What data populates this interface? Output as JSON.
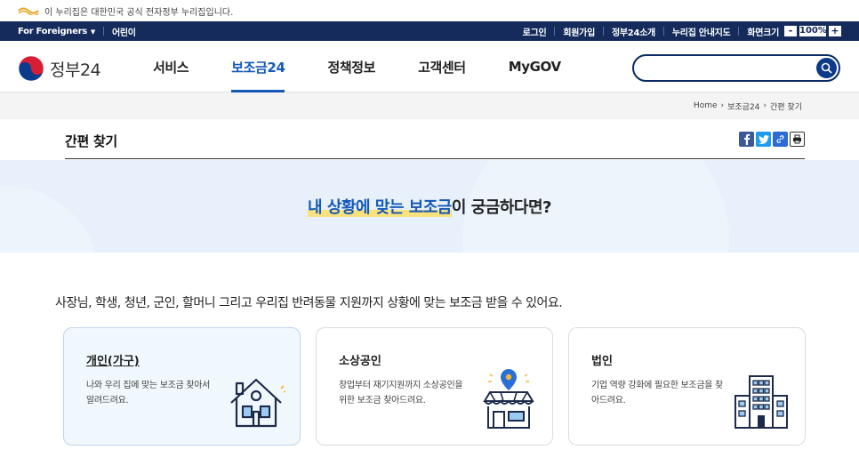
{
  "gov_banner": {
    "text": "이 누리집은 대한민국 공식 전자정부 누리집입니다."
  },
  "util": {
    "left": [
      "For Foreigners",
      "어린이"
    ],
    "right": [
      "로그인",
      "회원가입",
      "정부24소개",
      "누리집 안내지도",
      "화면크기"
    ],
    "zoom_minus": "-",
    "zoom_value": "100%",
    "zoom_plus": "+"
  },
  "nav": {
    "logo_text": "정부24",
    "menu": [
      "서비스",
      "보조금24",
      "정책정보",
      "고객센터",
      "MyGOV"
    ],
    "active_index": 1,
    "search_placeholder": ""
  },
  "breadcrumb": [
    "Home",
    "보조금24",
    "간편 찾기"
  ],
  "page_title": "간편 찾기",
  "hero": {
    "highlight": "내 상황에 맞는 보조금",
    "rest": "이 궁금하다면?"
  },
  "intro": "사장님, 학생, 청년, 군인, 할머니 그리고 우리집 반려동물 지원까지 상황에 맞는 보조금 받을 수 있어요.",
  "cards": [
    {
      "title": "개인(가구)",
      "desc": "나와 우리 집에 맞는 보조금 찾아서 알려드려요.",
      "icon": "house-icon"
    },
    {
      "title": "소상공인",
      "desc": "창업부터 재기지원까지 소상공인을 위한 보조금 찾아드려요.",
      "icon": "store-icon"
    },
    {
      "title": "법인",
      "desc": "기업 역량 강화에 필요한 보조금을 찾아드려요.",
      "icon": "building-icon"
    }
  ],
  "colors": {
    "navy": "#142b5c",
    "accent": "#1558b8",
    "hero_bg": "#e7f0fb",
    "highlight": "#f9e27e"
  }
}
